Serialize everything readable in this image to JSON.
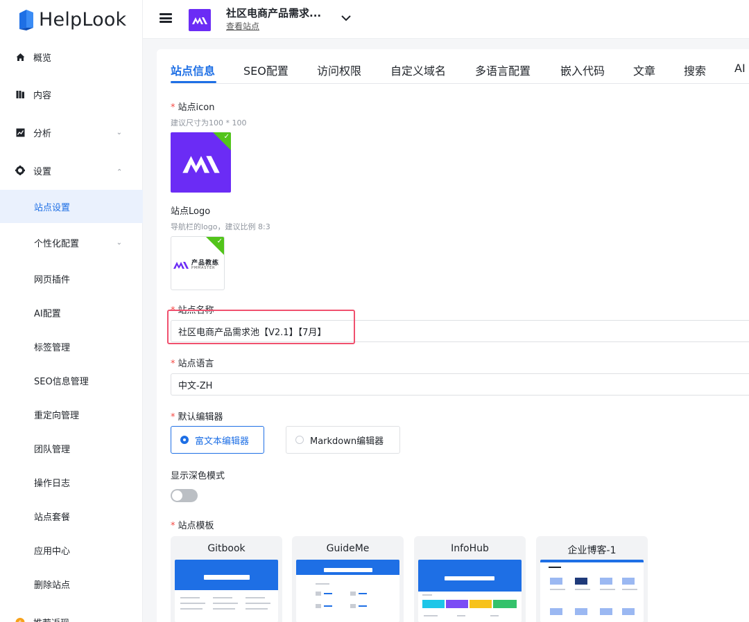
{
  "brand": {
    "name": "HelpLook"
  },
  "sidebar": {
    "items": [
      {
        "label": "概览",
        "icon": "home-icon"
      },
      {
        "label": "内容",
        "icon": "book-icon"
      },
      {
        "label": "分析",
        "icon": "chart-icon"
      },
      {
        "label": "设置",
        "icon": "gear-icon"
      }
    ],
    "sub_items": [
      {
        "label": "站点设置",
        "active": true
      },
      {
        "label": "个性化配置"
      },
      {
        "label": "网页插件"
      },
      {
        "label": "AI配置"
      },
      {
        "label": "标签管理"
      },
      {
        "label": "SEO信息管理"
      },
      {
        "label": "重定向管理"
      },
      {
        "label": "团队管理"
      },
      {
        "label": "操作日志"
      },
      {
        "label": "站点套餐"
      },
      {
        "label": "应用中心"
      },
      {
        "label": "删除站点"
      }
    ],
    "bottom_item": {
      "label": "推荐返现",
      "icon": "coin-icon"
    }
  },
  "header": {
    "site_title": "社区电商产品需求...",
    "view_site": "查看站点"
  },
  "tabs": [
    "站点信息",
    "SEO配置",
    "访问权限",
    "自定义域名",
    "多语言配置",
    "嵌入代码",
    "文章",
    "搜索",
    "AI"
  ],
  "form": {
    "required_mark": "*",
    "icon_label": "站点icon",
    "icon_hint": "建议尺寸为100 * 100",
    "logo_label": "站点Logo",
    "logo_hint": "导航栏的logo，建议比例 8:3",
    "logo_text_cn": "产品教练",
    "logo_text_en": "PMMASTER",
    "name_label": "站点名称",
    "name_value": "社区电商产品需求池【V2.1】【7月】",
    "lang_label": "站点语言",
    "lang_value": "中文-ZH",
    "editor_label": "默认编辑器",
    "editor_options": [
      "富文本编辑器",
      "Markdown编辑器"
    ],
    "editor_selected": "富文本编辑器",
    "dark_label": "显示深色模式",
    "dark_enabled": false,
    "template_label": "站点模板",
    "templates": [
      "Gitbook",
      "GuideMe",
      "InfoHub",
      "企业博客-1"
    ]
  },
  "colors": {
    "accent": "#1e6fe5",
    "brand_purple": "#6b2cf5",
    "success": "#52c41a",
    "highlight": "#f0506e"
  }
}
